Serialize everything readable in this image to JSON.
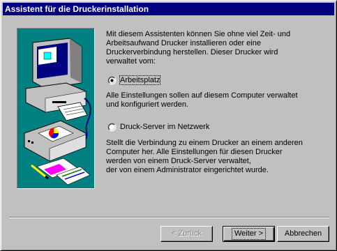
{
  "window": {
    "title": "Assistent für die Druckerinstallation"
  },
  "intro": {
    "line1": "Mit diesem Assistenten können Sie ohne viel Zeit- und",
    "line2": "Arbeitsaufwand Drucker installieren oder eine",
    "line3": "Druckerverbindung herstellen. Dieser Drucker wird",
    "line4": "verwaltet vom:"
  },
  "options": {
    "local": {
      "label": "Arbeitsplatz",
      "selected": true,
      "desc1": "Alle Einstellungen sollen auf diesem Computer verwaltet",
      "desc2": "und konfiguriert werden."
    },
    "network": {
      "label": "Druck-Server im Netzwerk",
      "selected": false,
      "desc1": "Stellt die Verbindung zu einem Drucker an einem anderen",
      "desc2": "Computer her. Alle Einstellungen für diesen Drucker",
      "desc3": "werden von einem Druck-Server verwaltet,",
      "desc4": "der von einem Administrator eingerichtet wurde."
    }
  },
  "buttons": {
    "back": "< Zurück",
    "next": "Weiter >",
    "cancel": "Abbrechen"
  },
  "colors": {
    "titlebar": "#000080",
    "illustration_bg": "#008080",
    "face": "#c0c0c0"
  }
}
